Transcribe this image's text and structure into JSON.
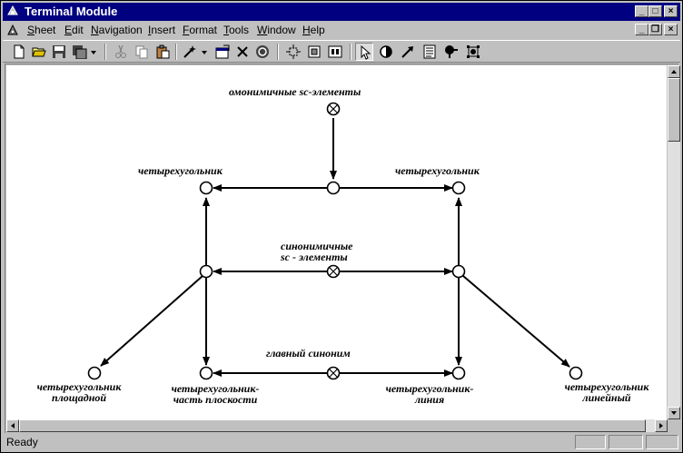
{
  "window": {
    "title": "Terminal Module"
  },
  "menu": {
    "items": [
      {
        "u": "S",
        "rest": "heet"
      },
      {
        "u": "E",
        "rest": "dit"
      },
      {
        "u": "N",
        "rest": "avigation"
      },
      {
        "u": "I",
        "rest": "nsert"
      },
      {
        "u": "F",
        "rest": "ormat"
      },
      {
        "u": "T",
        "rest": "ools"
      },
      {
        "u": "W",
        "rest": "indow"
      },
      {
        "u": "H",
        "rest": "elp"
      }
    ]
  },
  "toolbar": {
    "icons": [
      "new-document-icon",
      "open-folder-icon",
      "save-icon",
      "save-as-icon",
      "cut-icon",
      "copy-icon",
      "paste-icon",
      "wand-icon",
      "properties-icon",
      "delete-icon",
      "refresh-icon",
      "grid-icon",
      "zoom-fit-icon",
      "zoom-area-icon",
      "pointer-icon",
      "contrast-icon",
      "arrow-tool-icon",
      "text-tool-icon",
      "pin-icon",
      "node-tool-icon"
    ]
  },
  "diagram": {
    "labels": {
      "homonymous": "омонимичные sc-элементы",
      "quad_left": "четырехугольник",
      "quad_right": "четырехугольник",
      "synonymous_1": "синонимичные",
      "synonymous_2": "sc - элементы",
      "main_synonym": "главный синоним",
      "planar_1": "четырехугольник",
      "planar_2": "площадной",
      "plane_part_1": "четырехугольник-",
      "plane_part_2": "часть плоскости",
      "line_1": "четырехугольник-",
      "line_2": "линия",
      "linear_1": "четырехугольник",
      "linear_2": "линейный"
    }
  },
  "status": {
    "text": "Ready"
  }
}
